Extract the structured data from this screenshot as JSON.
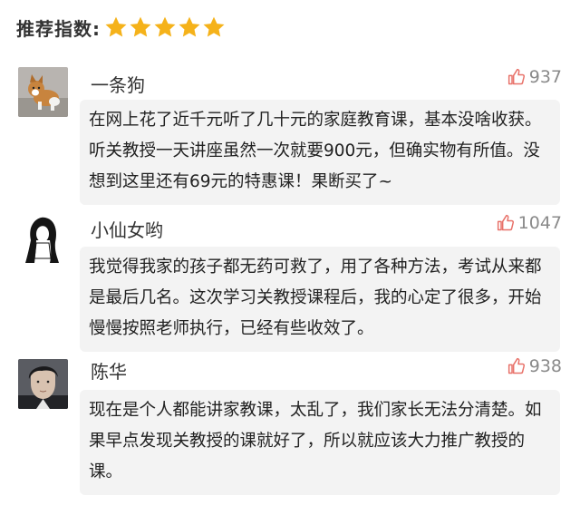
{
  "rating": {
    "label": "推荐指数:",
    "stars": 5,
    "star_color": "#f5b21a"
  },
  "comments": [
    {
      "username": "一条狗",
      "likes": "937",
      "avatar": "dog-photo",
      "text": "在网上花了近千元听了几十元的家庭教育课，基本没啥收获。听关教授一天讲座虽然一次就要900元，但确实物有所值。没想到这里还有69元的特惠课！果断买了~"
    },
    {
      "username": "小仙女哟",
      "likes": "1047",
      "avatar": "girl-sketch",
      "text": "我觉得我家的孩子都无药可救了，用了各种方法，考试从来都是最后几名。这次学习关教授课程后，我的心定了很多，开始慢慢按照老师执行，已经有些收效了。"
    },
    {
      "username": "陈华",
      "likes": "938",
      "avatar": "man-photo",
      "text": "现在是个人都能讲家教课，太乱了，我们家长无法分清楚。如果早点发现关教授的课就好了，所以就应该大力推广教授的课。"
    }
  ],
  "colors": {
    "thumb_icon": "#e8726a",
    "bubble_bg": "#f3f3f3",
    "likes_text": "#8a8a8a"
  }
}
